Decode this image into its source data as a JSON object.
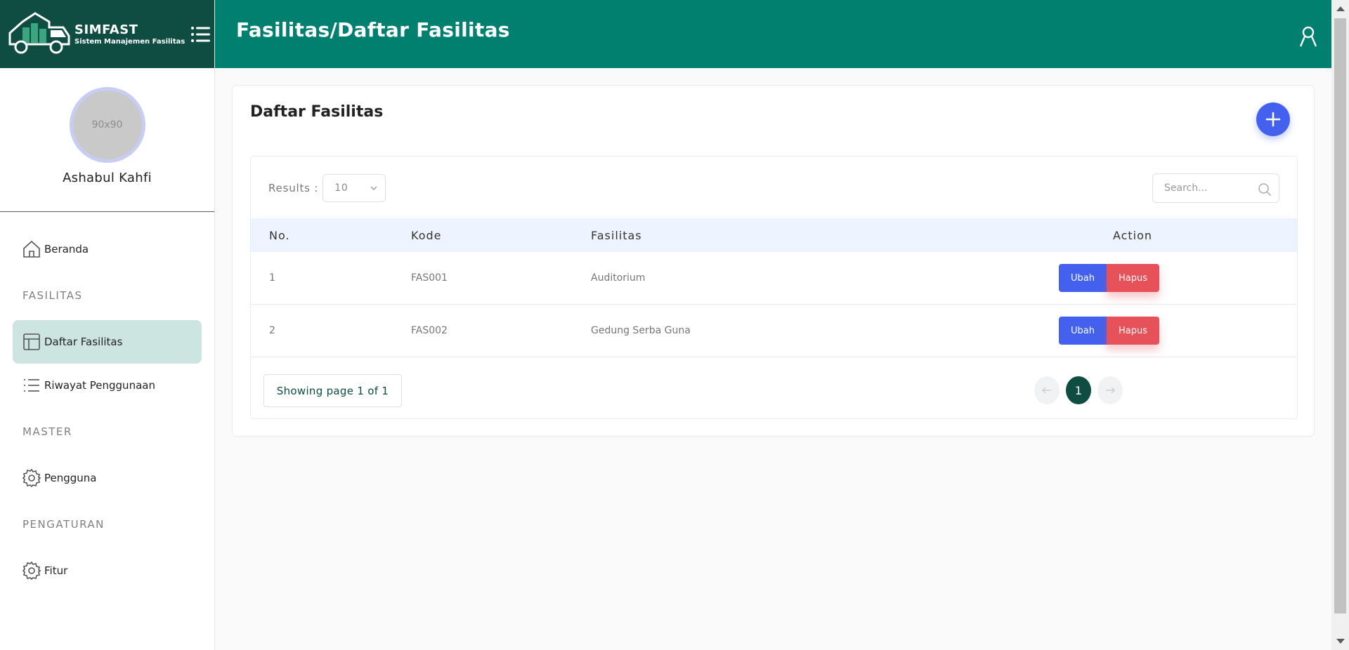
{
  "brand": {
    "name": "SIMFAST",
    "subtitle": "Sistem Manajemen Fasilitas"
  },
  "topbar": {
    "title": "Fasilitas/Daftar Fasilitas"
  },
  "profile": {
    "avatar_placeholder": "90x90",
    "name": "Ashabul Kahfi"
  },
  "sidebar": {
    "items": [
      {
        "label": "Beranda",
        "icon": "home-icon"
      },
      {
        "label": "FASILITAS",
        "type": "section"
      },
      {
        "label": "Daftar Fasilitas",
        "icon": "layout-icon",
        "active": true
      },
      {
        "label": "Riwayat Penggunaan",
        "icon": "list-icon"
      },
      {
        "label": "MASTER",
        "type": "section"
      },
      {
        "label": "Pengguna",
        "icon": "gear-icon"
      },
      {
        "label": "PENGATURAN",
        "type": "section"
      },
      {
        "label": "Fitur",
        "icon": "gear-icon"
      }
    ]
  },
  "card": {
    "title": "Daftar Fasilitas"
  },
  "table": {
    "results_label": "Results :",
    "page_size": "10",
    "search_placeholder": "Search...",
    "columns": [
      "No.",
      "Kode",
      "Fasilitas",
      "Action"
    ],
    "rows": [
      {
        "no": "1",
        "kode": "FAS001",
        "fasilitas": "Auditorium"
      },
      {
        "no": "2",
        "kode": "FAS002",
        "fasilitas": "Gedung Serba Guna"
      }
    ],
    "edit_label": "Ubah",
    "delete_label": "Hapus",
    "page_info": "Showing page 1 of 1",
    "current_page": "1"
  },
  "colors": {
    "brand_dark": "#0f4c42",
    "topbar": "#01806f",
    "primary": "#4361ee",
    "danger": "#e7515a",
    "active_bg": "#cde5e0"
  }
}
